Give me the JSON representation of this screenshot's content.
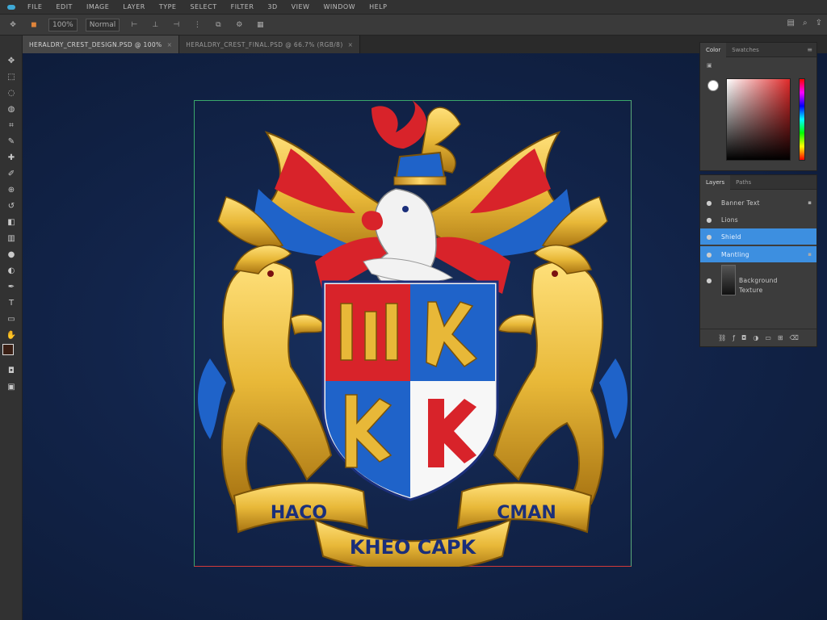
{
  "menu": {
    "items": [
      "FILE",
      "EDIT",
      "IMAGE",
      "LAYER",
      "TYPE",
      "SELECT",
      "FILTER",
      "3D",
      "VIEW",
      "WINDOW",
      "HELP"
    ]
  },
  "options": {
    "zoom": "100%",
    "mode": "Normal"
  },
  "tabs": [
    {
      "label": "HERALDRY_CREST_DESIGN.PSD @ 100%",
      "active": true
    },
    {
      "label": "HERALDRY_CREST_FINAL.PSD @ 66.7% (RGB/8)",
      "active": false
    }
  ],
  "toolbar": {
    "tools": [
      "move-icon",
      "marquee-icon",
      "lasso-icon",
      "quick-select-icon",
      "crop-icon",
      "eyedropper-icon",
      "healing-icon",
      "brush-icon",
      "clone-stamp-icon",
      "history-brush-icon",
      "eraser-icon",
      "gradient-icon",
      "blur-icon",
      "dodge-icon",
      "pen-icon",
      "type-icon",
      "path-select-icon",
      "shape-icon",
      "hand-icon",
      "zoom-icon",
      "edit-toolbar-icon"
    ],
    "foreground_color": "#3a1f14",
    "background_color": "#eeeeee"
  },
  "color_panel": {
    "tabs": [
      "Color",
      "Swatches"
    ],
    "base_color": "#e02a2a"
  },
  "layers_panel": {
    "tabs": [
      "Layers",
      "Paths"
    ],
    "layers": [
      {
        "name": "Banner Text",
        "selected": false
      },
      {
        "name": "Lions",
        "selected": false
      },
      {
        "name": "Shield",
        "selected": true
      },
      {
        "name": "Mantling",
        "selected": true
      },
      {
        "name": "Background",
        "selected": false
      },
      {
        "name": "Texture",
        "selected": false
      }
    ]
  },
  "artwork": {
    "banner_left": "HACO",
    "banner_right": "CMAN",
    "banner_bottom": "KHEO CAPK",
    "colors": {
      "gold": "#e8b838",
      "gold_dark": "#a87412",
      "red": "#d8232a",
      "blue": "#1f63c9",
      "navy": "#1b2f7a",
      "white": "#f2f2f2"
    }
  }
}
